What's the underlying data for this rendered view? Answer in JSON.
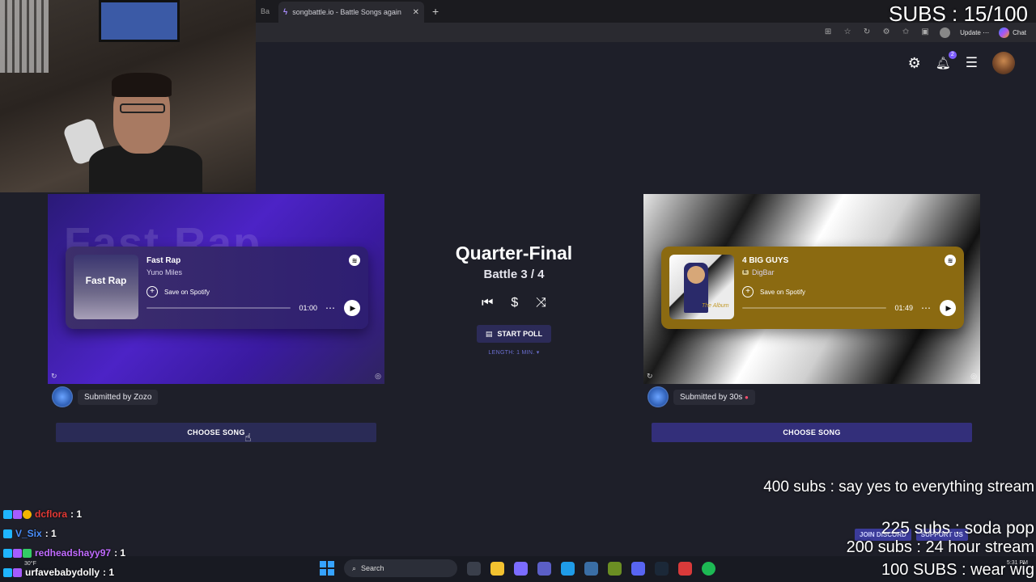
{
  "browser": {
    "partial_tab": "Ba",
    "tab_title": "songbattle.io - Battle Songs again",
    "update_label": "Update",
    "chat_label": "Chat"
  },
  "stream": {
    "subs_counter": "SUBS : 15/100",
    "goals": {
      "g400": "400 subs :  say yes to everything stream",
      "g225": "225 subs : soda pop",
      "g200": "200 subs : 24 hour stream",
      "g100": "100 SUBS : wear wig"
    },
    "links": {
      "discord": "JOIN DISCORD",
      "support": "SUPPORT US"
    },
    "chat": [
      {
        "name": "dcflora",
        "score": ": 1",
        "color": "#e53935"
      },
      {
        "name": "V_Six",
        "score": ": 1",
        "color": "#4a90ff"
      },
      {
        "name": "redheadshayy97",
        "score": ": 1",
        "color": "#c06bff"
      },
      {
        "name": "urfavebabydolly",
        "score": ": 1",
        "color": "#ffffff"
      }
    ]
  },
  "header": {
    "notification_count": "2"
  },
  "battle": {
    "round": "Quarter-Final",
    "count": "Battle 3 / 4",
    "start_poll": "START POLL",
    "length": "LENGTH: 1 MIN. ▾"
  },
  "left_song": {
    "bg_word": "Fast Rap",
    "art_text": "Fast Rap",
    "title": "Fast Rap",
    "artist": "Yuno Miles",
    "save": "Save on Spotify",
    "time": "01:00",
    "submitted_by": "Submitted by Zozo",
    "choose": "CHOOSE SONG"
  },
  "right_song": {
    "art_caption": "The Album",
    "title": "4 BIG GUYS",
    "explicit": "E",
    "artist": "DigBar",
    "save": "Save on Spotify",
    "time": "01:49",
    "submitted_by": "Submitted by 30s",
    "choose": "CHOOSE SONG"
  },
  "taskbar": {
    "search_placeholder": "Search",
    "weather": "30°F",
    "time": "5:31 PM"
  },
  "colors": {
    "accent": "#7c5cff",
    "button_bg": "#2b2a63",
    "page_bg": "#1e1f29"
  }
}
